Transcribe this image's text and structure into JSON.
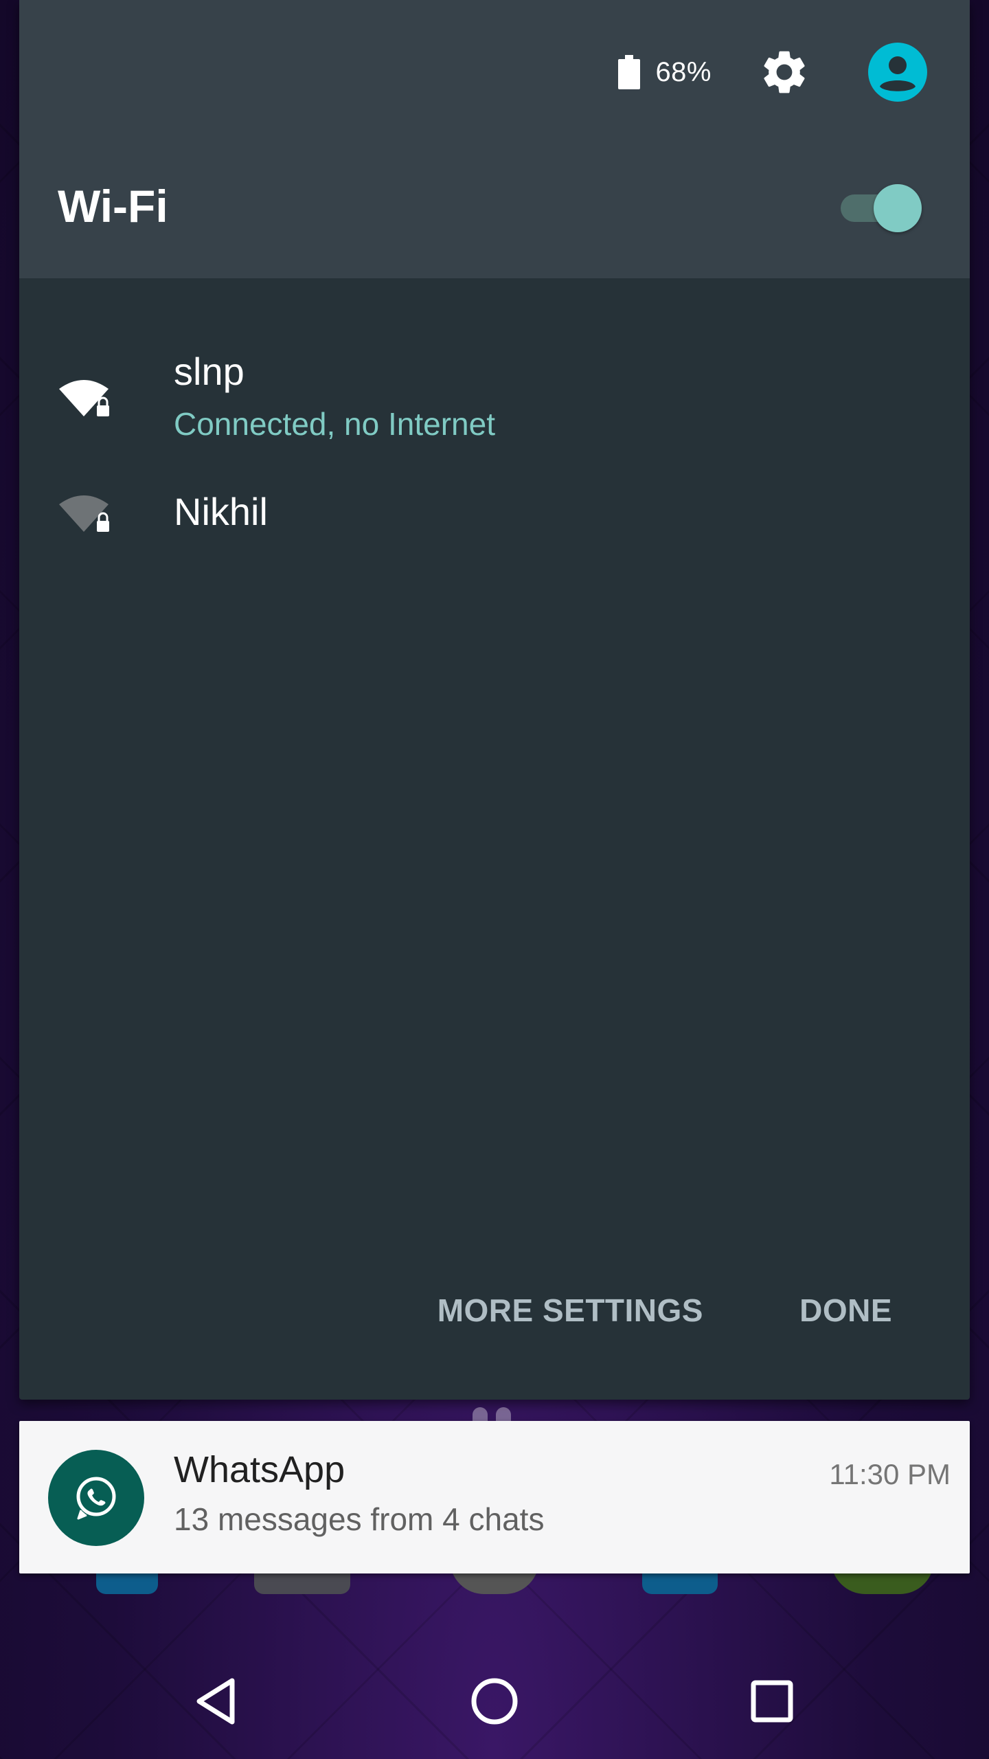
{
  "status": {
    "battery_percent": "68%",
    "settings_icon": "gear-icon",
    "account_icon": "account-circle-icon"
  },
  "wifi": {
    "title": "Wi-Fi",
    "enabled": true,
    "networks": [
      {
        "name": "slnp",
        "status": "Connected, no Internet",
        "secured": true,
        "signal": "full"
      },
      {
        "name": "Nikhil",
        "status": "",
        "secured": true,
        "signal": "weak"
      }
    ]
  },
  "actions": {
    "more_settings": "MORE SETTINGS",
    "done": "DONE"
  },
  "notification": {
    "app": "WhatsApp",
    "text": "13 messages from 4 chats",
    "time": "11:30 PM"
  },
  "navbar": {
    "back": "back-icon",
    "home": "home-icon",
    "recents": "recents-icon"
  },
  "colors": {
    "accent": "#80cbc4",
    "panel": "#263238",
    "header": "#37424a",
    "whatsapp": "#075e54"
  }
}
